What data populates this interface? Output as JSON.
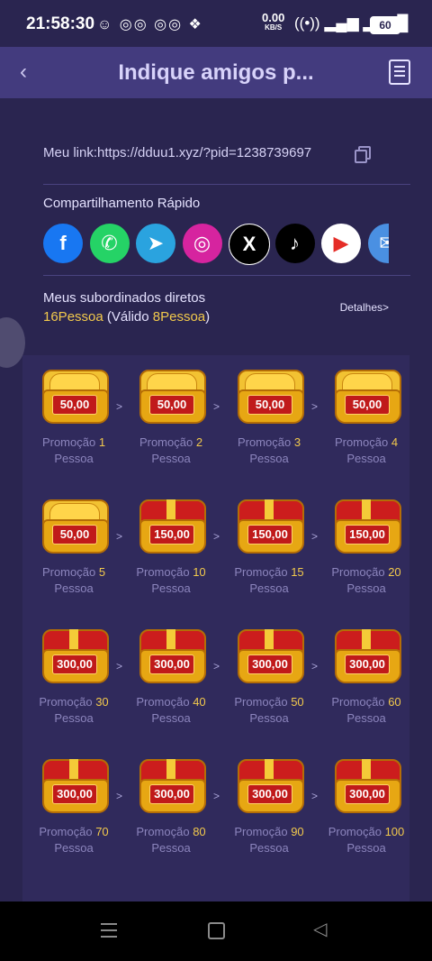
{
  "status": {
    "time": "21:58:30",
    "left_icons": "☺ ◎◎ ◎◎ ❖",
    "net_speed": "0.00",
    "net_unit": "KB/S",
    "right_icons": "((•)) ▂▄▆ ▂▄▆█",
    "battery": "60"
  },
  "header": {
    "back_icon": "back-chevron-icon",
    "title": "Indique amigos p...",
    "doc_icon": "document-icon"
  },
  "link": {
    "text": "Meu link:https://dduu1.xyz/?pid=1238739697",
    "copy_icon": "copy-icon"
  },
  "share": {
    "title": "Compartilhamento Rápido",
    "apps": [
      {
        "name": "facebook-icon",
        "glyph": "f",
        "color": "#1877f2"
      },
      {
        "name": "whatsapp-icon",
        "glyph": "✆",
        "color": "#25d366"
      },
      {
        "name": "telegram-icon",
        "glyph": "➤",
        "color": "#2aa3df"
      },
      {
        "name": "instagram-icon",
        "glyph": "◎",
        "color": "#d6249f"
      },
      {
        "name": "x-icon",
        "glyph": "X",
        "color": "#000000"
      },
      {
        "name": "tiktok-icon",
        "glyph": "♪",
        "color": "#000000"
      },
      {
        "name": "youtube-icon",
        "glyph": "▶",
        "color": "#ffffff"
      },
      {
        "name": "email-icon",
        "glyph": "✉",
        "color": "#4a90e2"
      }
    ]
  },
  "subordinates": {
    "label": "Meus subordinados diretos",
    "count": "16Pessoa",
    "valid_open": "(Válido ",
    "valid_count": "8Pessoa",
    "valid_close": ")",
    "details": "Detalhes>"
  },
  "rewards": [
    {
      "amount": "50,00",
      "promo": "Promoção",
      "n": "1",
      "unit": "Pessoa",
      "style": "open"
    },
    {
      "amount": "50,00",
      "promo": "Promoção",
      "n": "2",
      "unit": "Pessoa",
      "style": "open"
    },
    {
      "amount": "50,00",
      "promo": "Promoção",
      "n": "3",
      "unit": "Pessoa",
      "style": "open"
    },
    {
      "amount": "50,00",
      "promo": "Promoção",
      "n": "4",
      "unit": "Pessoa",
      "style": "open"
    },
    {
      "amount": "50,00",
      "promo": "Promoção",
      "n": "5",
      "unit": "Pessoa",
      "style": "open"
    },
    {
      "amount": "150,00",
      "promo": "Promoção",
      "n": "10",
      "unit": "Pessoa",
      "style": "red"
    },
    {
      "amount": "150,00",
      "promo": "Promoção",
      "n": "15",
      "unit": "Pessoa",
      "style": "red"
    },
    {
      "amount": "150,00",
      "promo": "Promoção",
      "n": "20",
      "unit": "Pessoa",
      "style": "red"
    },
    {
      "amount": "300,00",
      "promo": "Promoção",
      "n": "30",
      "unit": "Pessoa",
      "style": "red"
    },
    {
      "amount": "300,00",
      "promo": "Promoção",
      "n": "40",
      "unit": "Pessoa",
      "style": "red"
    },
    {
      "amount": "300,00",
      "promo": "Promoção",
      "n": "50",
      "unit": "Pessoa",
      "style": "red"
    },
    {
      "amount": "300,00",
      "promo": "Promoção",
      "n": "60",
      "unit": "Pessoa",
      "style": "red"
    },
    {
      "amount": "300,00",
      "promo": "Promoção",
      "n": "70",
      "unit": "Pessoa",
      "style": "red"
    },
    {
      "amount": "300,00",
      "promo": "Promoção",
      "n": "80",
      "unit": "Pessoa",
      "style": "red"
    },
    {
      "amount": "300,00",
      "promo": "Promoção",
      "n": "90",
      "unit": "Pessoa",
      "style": "red"
    },
    {
      "amount": "300,00",
      "promo": "Promoção",
      "n": "100",
      "unit": "Pessoa",
      "style": "red"
    }
  ],
  "arrow": ">",
  "navbar": {
    "menu_icon": "recent-apps-icon",
    "home_icon": "home-icon",
    "back_icon": "back-triangle-icon"
  }
}
